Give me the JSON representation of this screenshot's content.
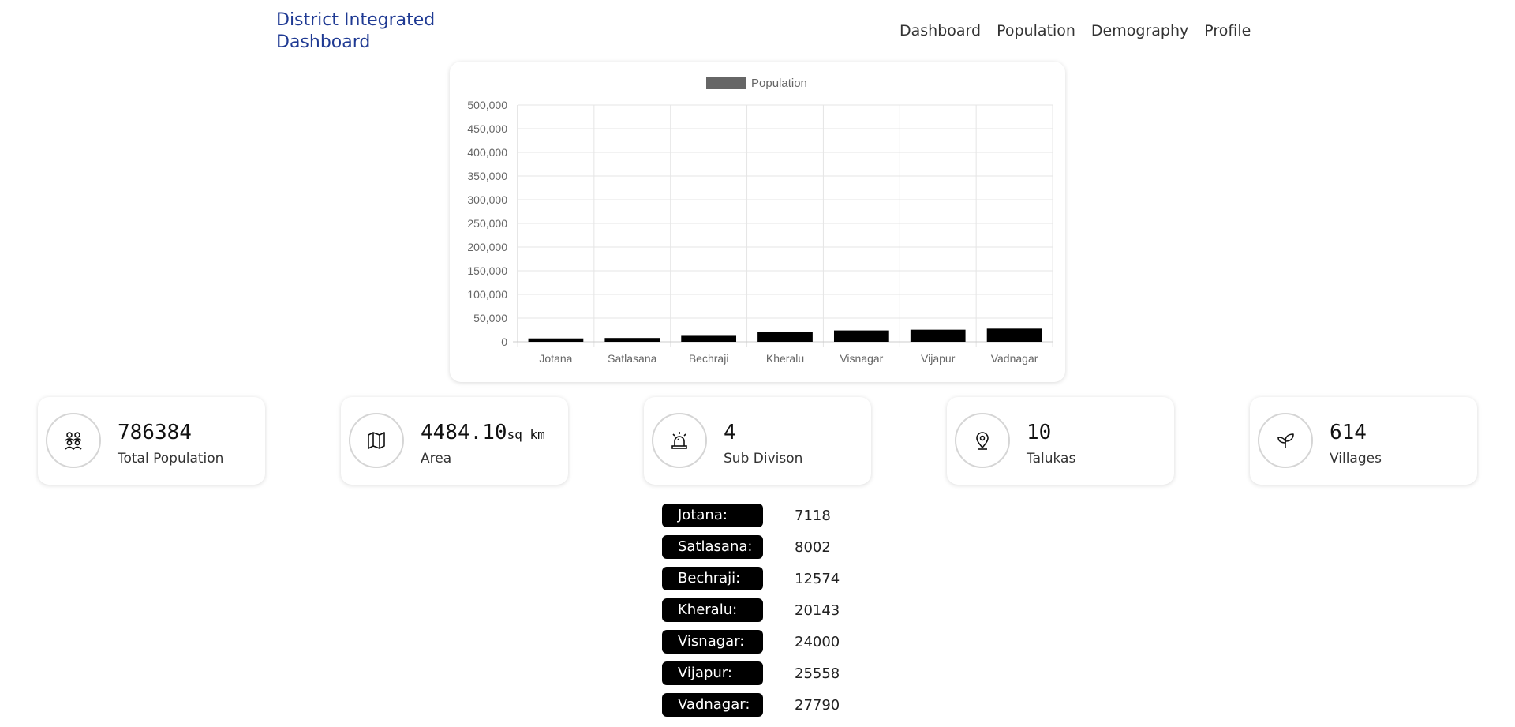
{
  "brand": {
    "title": "District Integrated Dashboard"
  },
  "nav": [
    "Dashboard",
    "Population",
    "Demography",
    "Profile"
  ],
  "chart_data": {
    "type": "bar",
    "categories": [
      "Jotana",
      "Satlasana",
      "Bechraji",
      "Kheralu",
      "Visnagar",
      "Vijapur",
      "Vadnagar"
    ],
    "series": [
      {
        "name": "Population",
        "values": [
          7118,
          8002,
          12574,
          20143,
          24000,
          25558,
          27790
        ]
      }
    ],
    "ylim": [
      0,
      500000
    ],
    "yticks": [
      "500,000",
      "450,000",
      "400,000",
      "350,000",
      "300,000",
      "250,000",
      "200,000",
      "150,000",
      "100,000",
      "50,000",
      "0"
    ],
    "grid": true,
    "legend_position": "top",
    "bar_color": "#000000",
    "legend_color": "#666666"
  },
  "stats": [
    {
      "value": "786384",
      "unit": "",
      "label": "Total Population",
      "icon": "people-group-icon"
    },
    {
      "value": "4484.10",
      "unit": "sq km",
      "label": "Area",
      "icon": "map-icon"
    },
    {
      "value": "4",
      "unit": "",
      "label": "Sub Divison",
      "icon": "alarm-siren-icon"
    },
    {
      "value": "10",
      "unit": "",
      "label": "Talukas",
      "icon": "location-pin-icon"
    },
    {
      "value": "614",
      "unit": "",
      "label": "Villages",
      "icon": "sprout-icon"
    }
  ],
  "talukas": [
    {
      "name": "Jotana:",
      "value": "7118"
    },
    {
      "name": "Satlasana:",
      "value": "8002"
    },
    {
      "name": "Bechraji:",
      "value": "12574"
    },
    {
      "name": "Kheralu:",
      "value": "20143"
    },
    {
      "name": "Visnagar:",
      "value": "24000"
    },
    {
      "name": "Vijapur:",
      "value": "25558"
    },
    {
      "name": "Vadnagar:",
      "value": "27790"
    }
  ]
}
